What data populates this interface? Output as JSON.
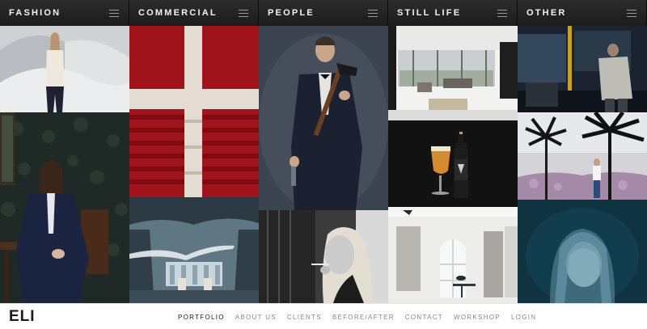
{
  "columns": [
    {
      "title": "FASHION"
    },
    {
      "title": "COMMERCIAL"
    },
    {
      "title": "PEOPLE"
    },
    {
      "title": "STILL LIFE"
    },
    {
      "title": "OTHER"
    }
  ],
  "footer": {
    "logo": "ELI",
    "nav": [
      "PORTFOLIO",
      "ABOUT US",
      "CLIENTS",
      "BEFORE/AFTER",
      "CONTACT",
      "WORKSHOP",
      "LOGIN"
    ],
    "active_nav": "PORTFOLIO"
  },
  "colors": {
    "header_bg": "#222222",
    "header_text": "#f2f2f2",
    "nav_active": "#1a1a1a",
    "nav_inactive": "#8a8a8a"
  },
  "icons": [
    "hamburger-menu-icon"
  ]
}
